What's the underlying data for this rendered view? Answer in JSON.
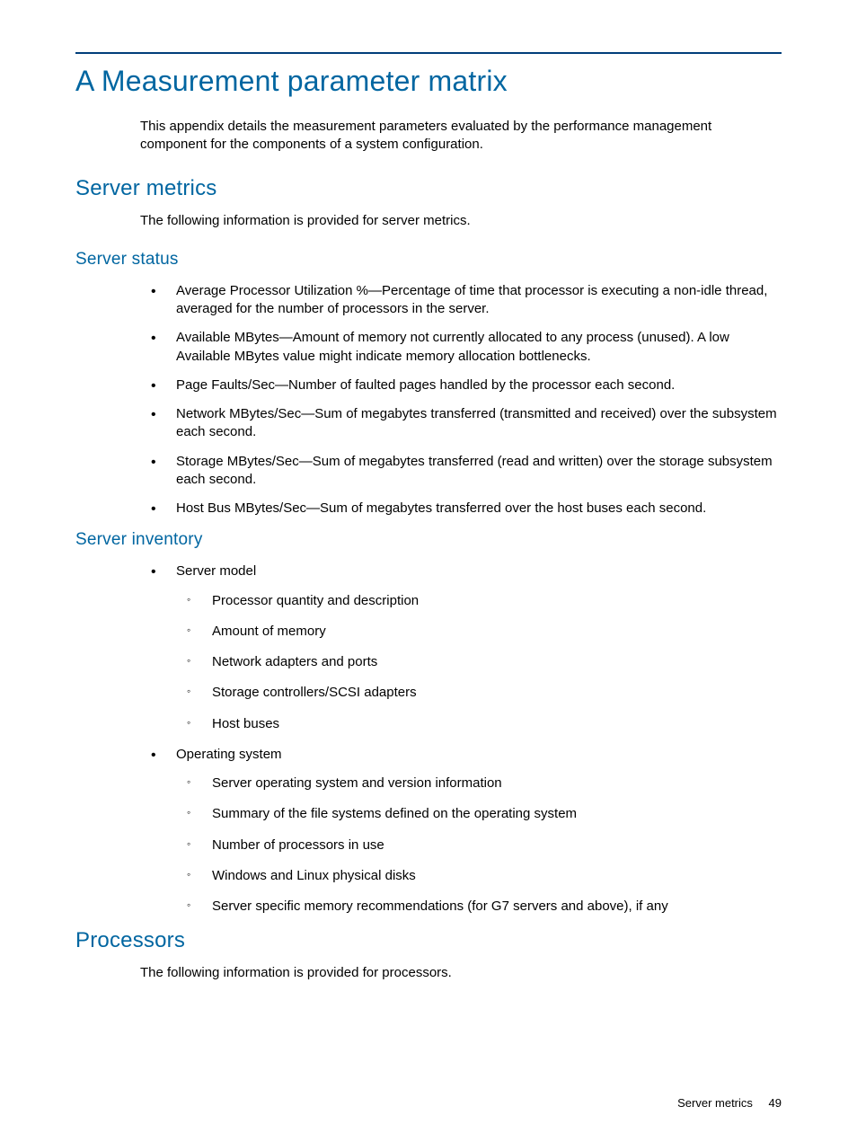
{
  "page_title": "A Measurement parameter matrix",
  "intro": "This appendix details the measurement parameters evaluated by the performance management component for the components of a system configuration.",
  "section_server_metrics": {
    "heading": "Server metrics",
    "intro": "The following information is provided for server metrics."
  },
  "section_server_status": {
    "heading": "Server status",
    "items": [
      "Average Processor Utilization %—Percentage of time that processor is executing a non-idle thread, averaged for the number of processors in the server.",
      "Available MBytes—Amount of memory not currently allocated to any process (unused). A low Available MBytes value might indicate memory allocation bottlenecks.",
      "Page Faults/Sec—Number of faulted pages handled by the processor each second.",
      "Network MBytes/Sec—Sum of megabytes transferred (transmitted and received) over the subsystem each second.",
      "Storage MBytes/Sec—Sum of megabytes transferred (read and written) over the storage subsystem each second.",
      "Host Bus MBytes/Sec—Sum of megabytes transferred over the host buses each second."
    ]
  },
  "section_server_inventory": {
    "heading": "Server inventory",
    "items": [
      {
        "label": "Server model",
        "sub": [
          "Processor quantity and description",
          "Amount of memory",
          "Network adapters and ports",
          "Storage controllers/SCSI adapters",
          "Host buses"
        ]
      },
      {
        "label": "Operating system",
        "sub": [
          "Server operating system and version information",
          "Summary of the file systems defined on the operating system",
          "Number of processors in use",
          "Windows and Linux physical disks",
          "Server specific memory recommendations (for G7 servers and above), if any"
        ]
      }
    ]
  },
  "section_processors": {
    "heading": "Processors",
    "intro": "The following information is provided for processors."
  },
  "footer": {
    "title": "Server metrics",
    "page_number": "49"
  }
}
